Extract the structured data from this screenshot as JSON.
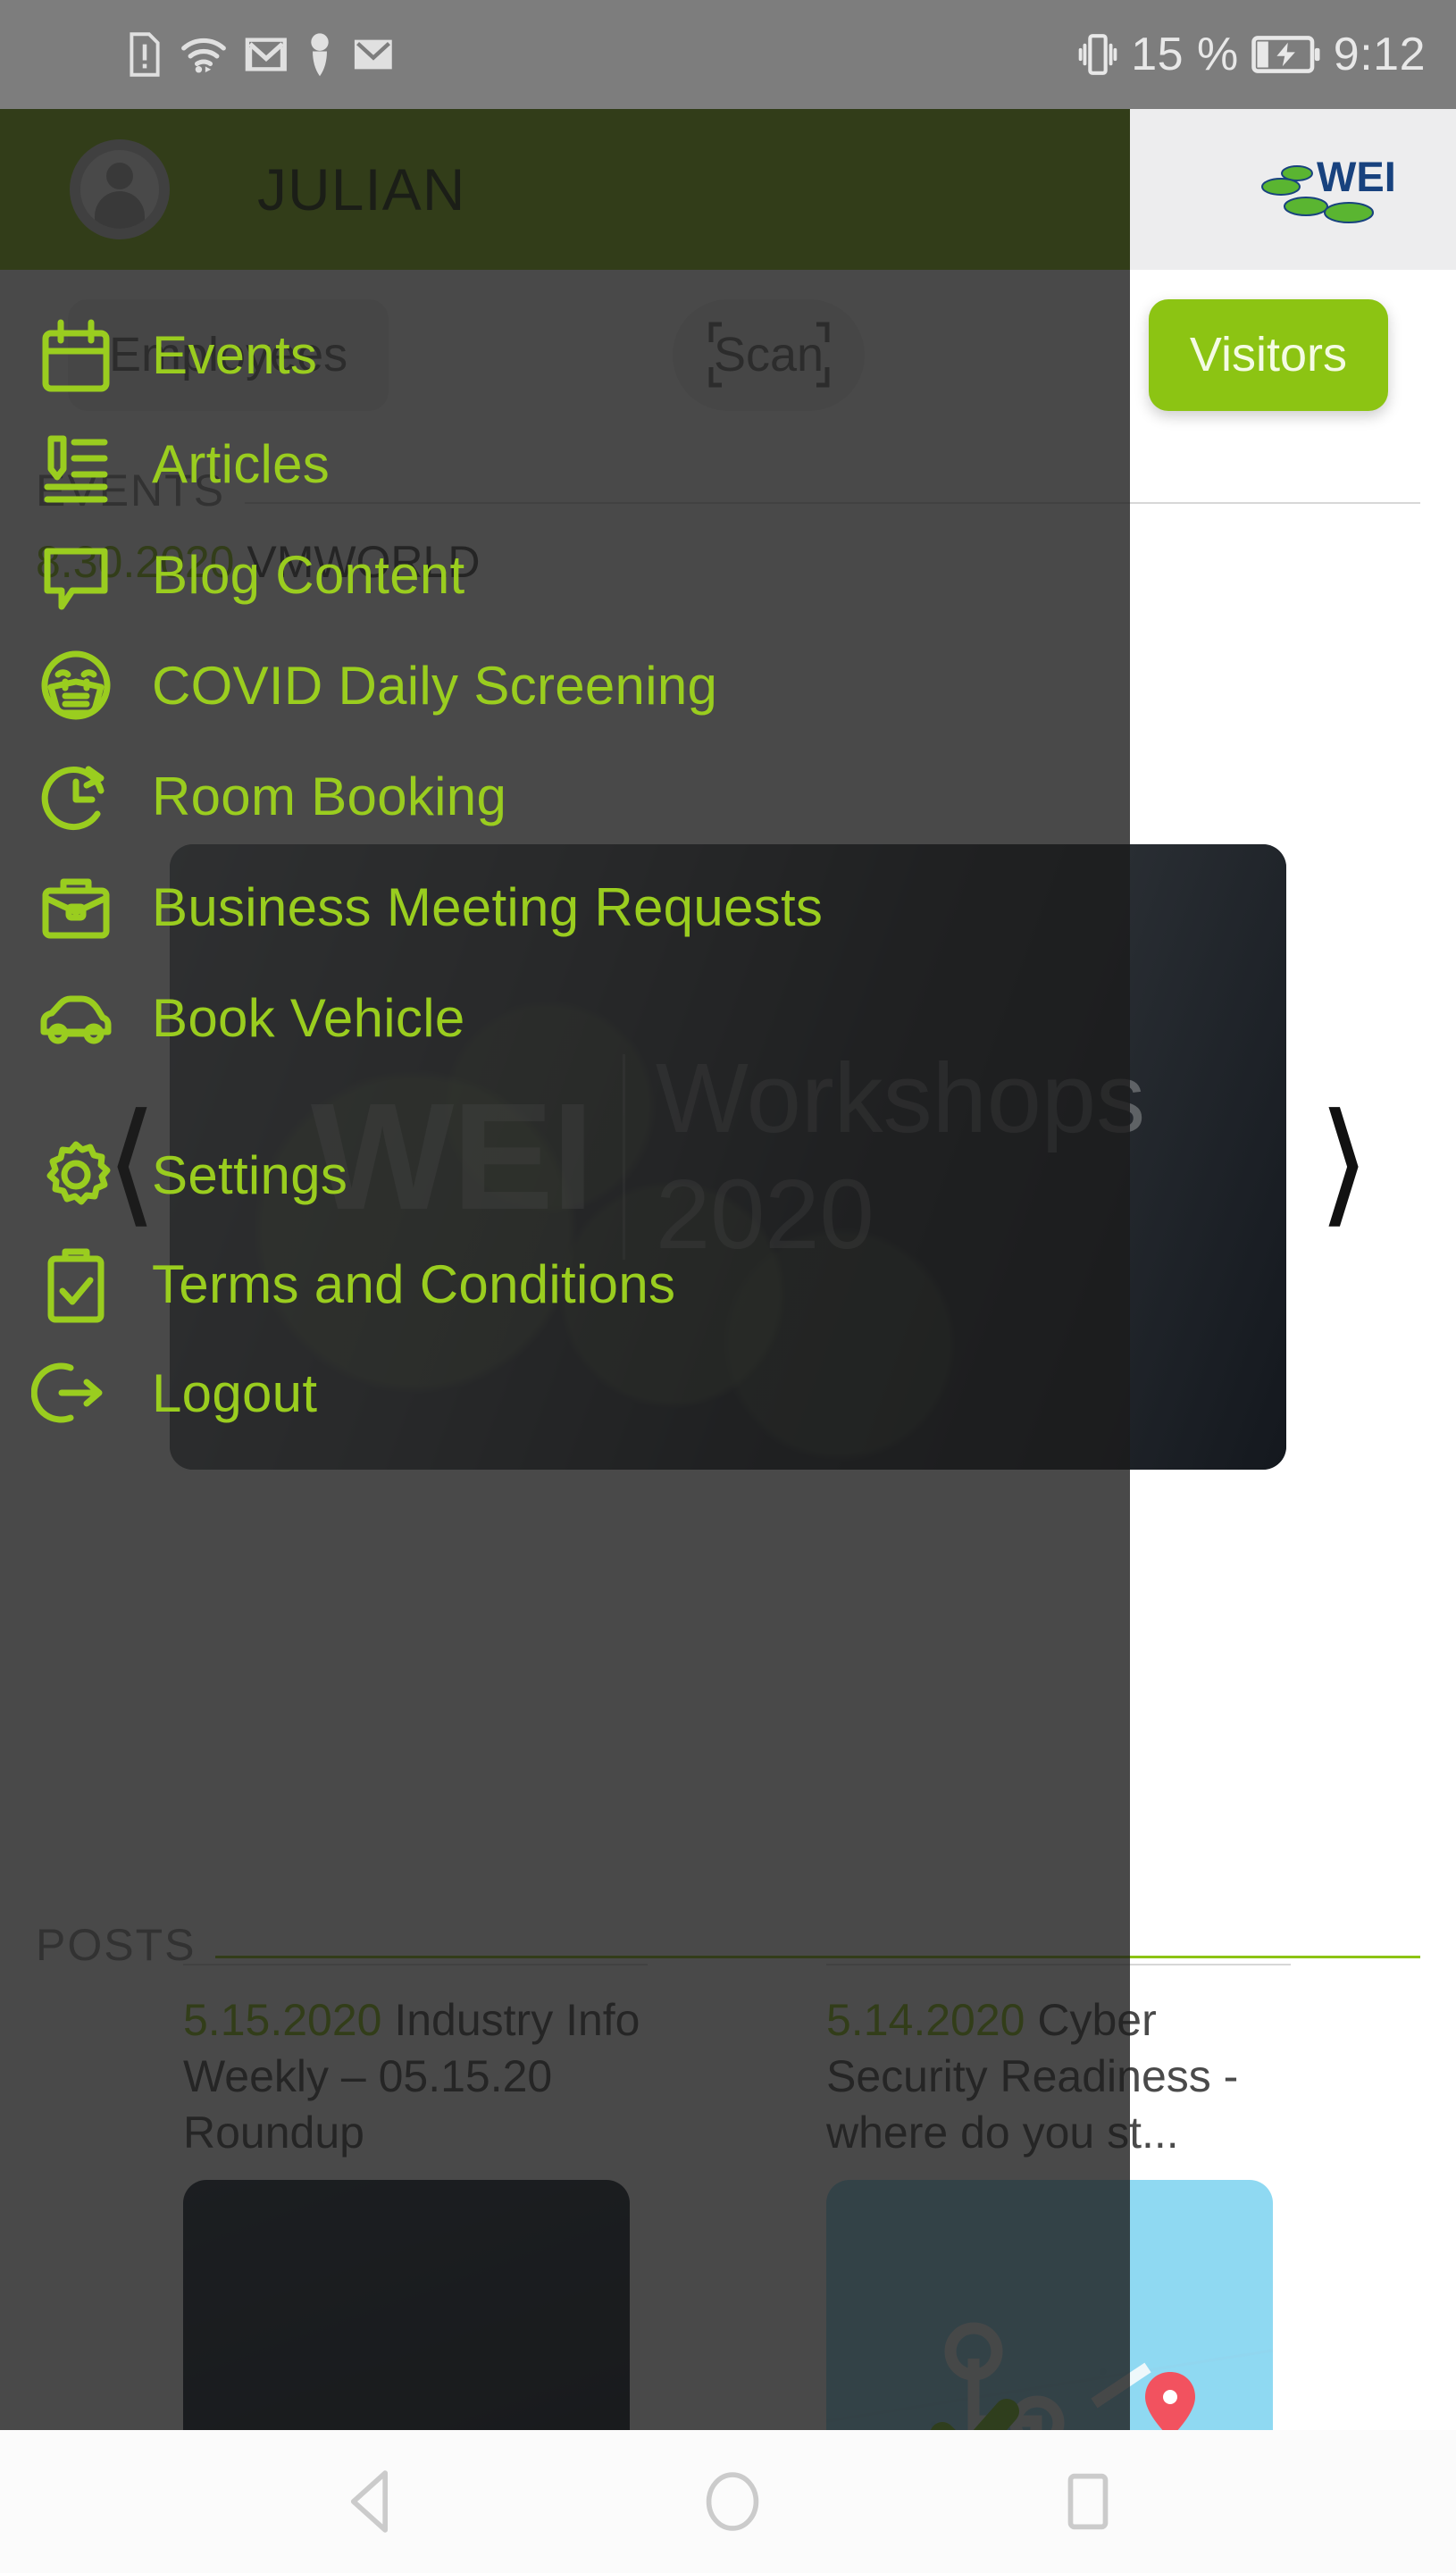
{
  "status_bar": {
    "icons_left": [
      "sim-alert-icon",
      "wifi-icon",
      "gmail-icon",
      "location-person-icon",
      "envelope-icon"
    ],
    "vibrate_icon": "vibrate-icon",
    "battery_percent": "15 %",
    "battery_icon": "battery-charging-icon",
    "time": "9:12"
  },
  "app_bar": {
    "username": "JULIAN",
    "avatar_icon": "user-avatar-icon",
    "logo_text": "WEI",
    "logo_colors": {
      "text": "#18427e",
      "stone": "#5ab531"
    }
  },
  "tabs": [
    {
      "label": "Employees",
      "active": false,
      "icon": ""
    },
    {
      "label": "Scan",
      "active": false,
      "icon": "scan-brackets-icon"
    },
    {
      "label": "Visitors",
      "active": true,
      "icon": ""
    }
  ],
  "sections": {
    "events_title": "EVENTS",
    "posts_title": "POSTS"
  },
  "events": [
    {
      "date": "8.30.2020",
      "title": "VMWORLD"
    }
  ],
  "carousel": {
    "brand": "WEI",
    "line1": "Workshops",
    "line2": "2020",
    "prev_icon": "chevron-left-icon",
    "next_icon": "chevron-right-icon"
  },
  "posts": [
    {
      "date": "5.15.2020",
      "title": "Industry Info Weekly – 05.15.20 Roundup"
    },
    {
      "date": "5.14.2020",
      "title": "Cyber Security Readiness - where do you st..."
    }
  ],
  "drawer": {
    "items": [
      {
        "label": "Events",
        "icon": "calendar-icon"
      },
      {
        "label": "Articles",
        "icon": "article-list-icon"
      },
      {
        "label": "Blog Content",
        "icon": "speech-bubble-icon"
      },
      {
        "label": "COVID Daily Screening",
        "icon": "face-mask-icon"
      },
      {
        "label": "Room Booking",
        "icon": "clock-refresh-icon"
      },
      {
        "label": "Business Meeting Requests",
        "icon": "briefcase-icon"
      },
      {
        "label": "Book Vehicle",
        "icon": "car-icon"
      },
      {
        "label": "Settings",
        "icon": "gear-icon"
      },
      {
        "label": "Terms and Conditions",
        "icon": "clipboard-check-icon"
      },
      {
        "label": "Logout",
        "icon": "logout-icon"
      }
    ],
    "accent_color": "#9acd1f"
  },
  "nav_bar": {
    "back_icon": "back-triangle-icon",
    "home_icon": "home-circle-icon",
    "recents_icon": "recents-square-icon"
  }
}
